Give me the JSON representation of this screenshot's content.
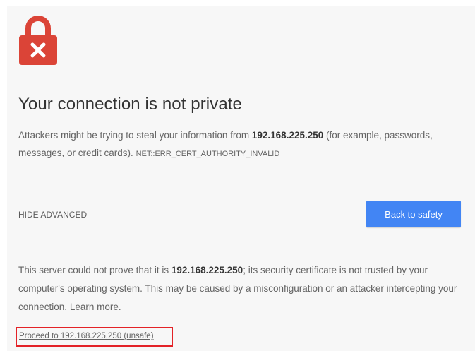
{
  "title": "Your connection is not private",
  "description": {
    "prefix": "Attackers might be trying to steal your information from ",
    "host": "192.168.225.250",
    "suffix": " (for example, passwords, messages, or credit cards). ",
    "error_code": "NET::ERR_CERT_AUTHORITY_INVALID"
  },
  "actions": {
    "hide_advanced": "HIDE ADVANCED",
    "back_to_safety": "Back to safety"
  },
  "details": {
    "prefix": "This server could not prove that it is ",
    "host": "192.168.225.250",
    "suffix": "; its security certificate is not trusted by your computer's operating system. This may be caused by a misconfiguration or an attacker intercepting your connection. ",
    "learn_more": "Learn more",
    "end": "."
  },
  "proceed_link": "Proceed to 192.168.225.250 (unsafe)",
  "colors": {
    "lock_red": "#db4437",
    "button_blue": "#4285f4",
    "highlight_border": "#e32227",
    "background": "#f7f7f7"
  },
  "icons": {
    "lock": "lock-broken-icon"
  }
}
